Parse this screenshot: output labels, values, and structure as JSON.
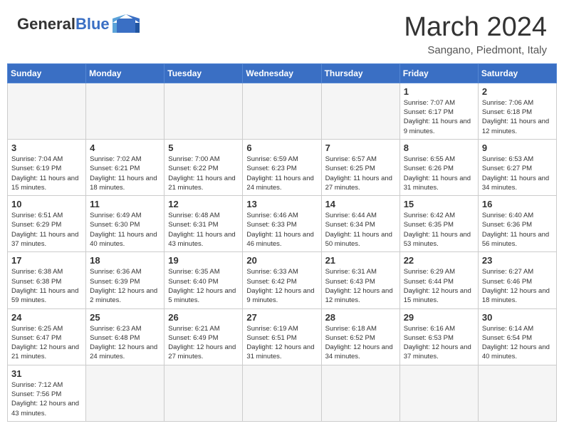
{
  "logo": {
    "text_general": "General",
    "text_blue": "Blue"
  },
  "header": {
    "month_year": "March 2024",
    "location": "Sangano, Piedmont, Italy"
  },
  "days_of_week": [
    "Sunday",
    "Monday",
    "Tuesday",
    "Wednesday",
    "Thursday",
    "Friday",
    "Saturday"
  ],
  "weeks": [
    [
      {
        "day": "",
        "info": ""
      },
      {
        "day": "",
        "info": ""
      },
      {
        "day": "",
        "info": ""
      },
      {
        "day": "",
        "info": ""
      },
      {
        "day": "",
        "info": ""
      },
      {
        "day": "1",
        "info": "Sunrise: 7:07 AM\nSunset: 6:17 PM\nDaylight: 11 hours\nand 9 minutes."
      },
      {
        "day": "2",
        "info": "Sunrise: 7:06 AM\nSunset: 6:18 PM\nDaylight: 11 hours\nand 12 minutes."
      }
    ],
    [
      {
        "day": "3",
        "info": "Sunrise: 7:04 AM\nSunset: 6:19 PM\nDaylight: 11 hours\nand 15 minutes."
      },
      {
        "day": "4",
        "info": "Sunrise: 7:02 AM\nSunset: 6:21 PM\nDaylight: 11 hours\nand 18 minutes."
      },
      {
        "day": "5",
        "info": "Sunrise: 7:00 AM\nSunset: 6:22 PM\nDaylight: 11 hours\nand 21 minutes."
      },
      {
        "day": "6",
        "info": "Sunrise: 6:59 AM\nSunset: 6:23 PM\nDaylight: 11 hours\nand 24 minutes."
      },
      {
        "day": "7",
        "info": "Sunrise: 6:57 AM\nSunset: 6:25 PM\nDaylight: 11 hours\nand 27 minutes."
      },
      {
        "day": "8",
        "info": "Sunrise: 6:55 AM\nSunset: 6:26 PM\nDaylight: 11 hours\nand 31 minutes."
      },
      {
        "day": "9",
        "info": "Sunrise: 6:53 AM\nSunset: 6:27 PM\nDaylight: 11 hours\nand 34 minutes."
      }
    ],
    [
      {
        "day": "10",
        "info": "Sunrise: 6:51 AM\nSunset: 6:29 PM\nDaylight: 11 hours\nand 37 minutes."
      },
      {
        "day": "11",
        "info": "Sunrise: 6:49 AM\nSunset: 6:30 PM\nDaylight: 11 hours\nand 40 minutes."
      },
      {
        "day": "12",
        "info": "Sunrise: 6:48 AM\nSunset: 6:31 PM\nDaylight: 11 hours\nand 43 minutes."
      },
      {
        "day": "13",
        "info": "Sunrise: 6:46 AM\nSunset: 6:33 PM\nDaylight: 11 hours\nand 46 minutes."
      },
      {
        "day": "14",
        "info": "Sunrise: 6:44 AM\nSunset: 6:34 PM\nDaylight: 11 hours\nand 50 minutes."
      },
      {
        "day": "15",
        "info": "Sunrise: 6:42 AM\nSunset: 6:35 PM\nDaylight: 11 hours\nand 53 minutes."
      },
      {
        "day": "16",
        "info": "Sunrise: 6:40 AM\nSunset: 6:36 PM\nDaylight: 11 hours\nand 56 minutes."
      }
    ],
    [
      {
        "day": "17",
        "info": "Sunrise: 6:38 AM\nSunset: 6:38 PM\nDaylight: 11 hours\nand 59 minutes."
      },
      {
        "day": "18",
        "info": "Sunrise: 6:36 AM\nSunset: 6:39 PM\nDaylight: 12 hours\nand 2 minutes."
      },
      {
        "day": "19",
        "info": "Sunrise: 6:35 AM\nSunset: 6:40 PM\nDaylight: 12 hours\nand 5 minutes."
      },
      {
        "day": "20",
        "info": "Sunrise: 6:33 AM\nSunset: 6:42 PM\nDaylight: 12 hours\nand 9 minutes."
      },
      {
        "day": "21",
        "info": "Sunrise: 6:31 AM\nSunset: 6:43 PM\nDaylight: 12 hours\nand 12 minutes."
      },
      {
        "day": "22",
        "info": "Sunrise: 6:29 AM\nSunset: 6:44 PM\nDaylight: 12 hours\nand 15 minutes."
      },
      {
        "day": "23",
        "info": "Sunrise: 6:27 AM\nSunset: 6:46 PM\nDaylight: 12 hours\nand 18 minutes."
      }
    ],
    [
      {
        "day": "24",
        "info": "Sunrise: 6:25 AM\nSunset: 6:47 PM\nDaylight: 12 hours\nand 21 minutes."
      },
      {
        "day": "25",
        "info": "Sunrise: 6:23 AM\nSunset: 6:48 PM\nDaylight: 12 hours\nand 24 minutes."
      },
      {
        "day": "26",
        "info": "Sunrise: 6:21 AM\nSunset: 6:49 PM\nDaylight: 12 hours\nand 27 minutes."
      },
      {
        "day": "27",
        "info": "Sunrise: 6:19 AM\nSunset: 6:51 PM\nDaylight: 12 hours\nand 31 minutes."
      },
      {
        "day": "28",
        "info": "Sunrise: 6:18 AM\nSunset: 6:52 PM\nDaylight: 12 hours\nand 34 minutes."
      },
      {
        "day": "29",
        "info": "Sunrise: 6:16 AM\nSunset: 6:53 PM\nDaylight: 12 hours\nand 37 minutes."
      },
      {
        "day": "30",
        "info": "Sunrise: 6:14 AM\nSunset: 6:54 PM\nDaylight: 12 hours\nand 40 minutes."
      }
    ],
    [
      {
        "day": "31",
        "info": "Sunrise: 7:12 AM\nSunset: 7:56 PM\nDaylight: 12 hours\nand 43 minutes."
      },
      {
        "day": "",
        "info": ""
      },
      {
        "day": "",
        "info": ""
      },
      {
        "day": "",
        "info": ""
      },
      {
        "day": "",
        "info": ""
      },
      {
        "day": "",
        "info": ""
      },
      {
        "day": "",
        "info": ""
      }
    ]
  ]
}
